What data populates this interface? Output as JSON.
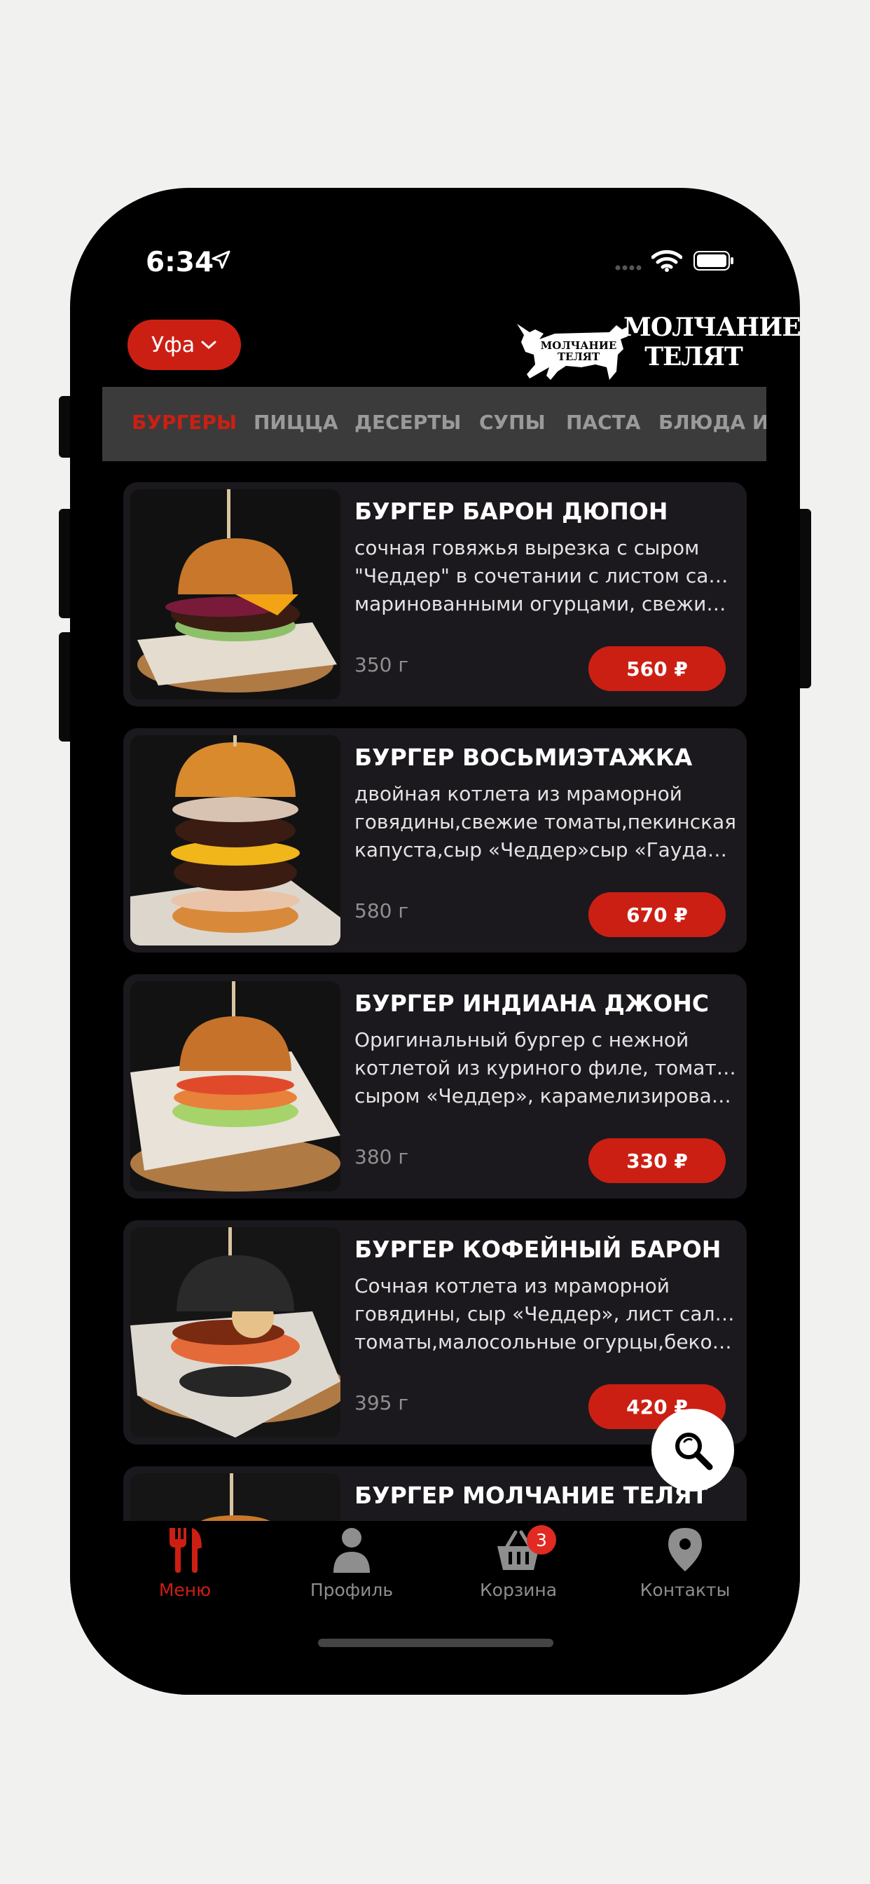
{
  "status_bar": {
    "time": "6:34"
  },
  "header": {
    "city": "Уфа",
    "logo_text_line1": "МОЛЧАНИЕ",
    "logo_text_line2": "ТЕЛЯТ",
    "logo_badge_line1": "МОЛЧАНИЕ",
    "logo_badge_line2": "ТЕЛЯТ"
  },
  "categories": [
    {
      "label": "БУРГЕРЫ",
      "active": true
    },
    {
      "label": "ПИЦЦА",
      "active": false
    },
    {
      "label": "ДЕСЕРТЫ",
      "active": false
    },
    {
      "label": "СУПЫ",
      "active": false
    },
    {
      "label": "ПАСТА",
      "active": false
    },
    {
      "label": "БЛЮДА ИЗ",
      "active": false
    }
  ],
  "products": [
    {
      "title": "БУРГЕР БАРОН ДЮПОН",
      "desc": [
        "сочная говяжья вырезка с сыром",
        "\"Чеддер\" в сочетании с листом салата,",
        "маринованными огурцами, свежим…"
      ],
      "weight": "350 г",
      "price": "560 ₽"
    },
    {
      "title": "БУРГЕР ВОСЬМИЭТАЖКА",
      "desc": [
        "двойная котлета из мраморной",
        "говядины,свежие томаты,пекинская",
        "капуста,сыр «Чеддер»сыр «Гауда»,ка…"
      ],
      "weight": "580 г",
      "price": "670 ₽"
    },
    {
      "title": "БУРГЕР ИНДИАНА ДЖОНС",
      "desc": [
        "Оригинальный бургер с нежной",
        "котлетой из куриного филе, томатами,",
        "сыром «Чеддер», карамелизированн…"
      ],
      "weight": "380 г",
      "price": "330 ₽"
    },
    {
      "title": "БУРГЕР КОФЕЙНЫЙ БАРОН",
      "desc": [
        "Сочная котлета из мраморной",
        "говядины, сыр «Чеддер», лист салата,",
        "томаты,малосольные огурцы,бекон,…"
      ],
      "weight": "395 г",
      "price": "420 ₽"
    },
    {
      "title": "БУРГЕР МОЛЧАНИЕ ТЕЛЯТ",
      "desc": [
        "",
        "",
        ""
      ],
      "weight": "",
      "price": ""
    }
  ],
  "tabbar": {
    "menu": "Меню",
    "profile": "Профиль",
    "cart": "Корзина",
    "contacts": "Контакты",
    "cart_badge": "3"
  },
  "colors": {
    "accent": "#cc1f14",
    "card_bg": "#1b191d",
    "category_bar_bg": "#3b3b3b"
  },
  "icons": [
    "location-arrow-icon",
    "wifi-icon",
    "battery-icon",
    "chevron-down-icon",
    "search-icon",
    "fork-knife-icon",
    "user-icon",
    "basket-icon",
    "map-pin-icon"
  ]
}
